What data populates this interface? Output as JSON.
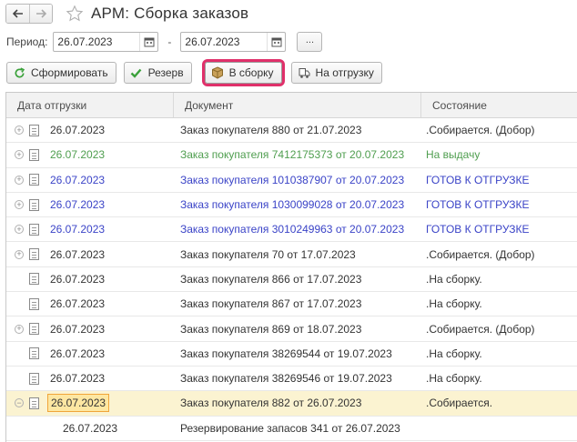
{
  "window": {
    "title": "АРМ: Сборка заказов"
  },
  "nav": {
    "back_icon": "arrow-left-icon",
    "forward_icon": "arrow-right-icon",
    "favorite_icon": "star-icon"
  },
  "period": {
    "label": "Период:",
    "from": "26.07.2023",
    "separator": "-",
    "to": "26.07.2023",
    "more_label": "..."
  },
  "toolbar": {
    "generate_label": "Сформировать",
    "reserve_label": "Резерв",
    "to_assembly_label": "В сборку",
    "to_shipment_label": "На отгрузку"
  },
  "table": {
    "columns": [
      "Дата отгрузки",
      "Документ",
      "Состояние"
    ],
    "rows": [
      {
        "date": "26.07.2023",
        "doc": "Заказ покупателя 880 от 21.07.2023",
        "state": ".Собирается. (Добор)"
      },
      {
        "date": "26.07.2023",
        "doc": "Заказ покупателя 7412175373 от 20.07.2023",
        "state": "На выдачу"
      },
      {
        "date": "26.07.2023",
        "doc": "Заказ покупателя 1010387907 от 20.07.2023",
        "state": "ГОТОВ К ОТГРУЗКЕ"
      },
      {
        "date": "26.07.2023",
        "doc": "Заказ покупателя 1030099028 от 20.07.2023",
        "state": "ГОТОВ К ОТГРУЗКЕ"
      },
      {
        "date": "26.07.2023",
        "doc": "Заказ покупателя 3010249963 от 20.07.2023",
        "state": "ГОТОВ К ОТГРУЗКЕ"
      },
      {
        "date": "26.07.2023",
        "doc": "Заказ покупателя 70 от 17.07.2023",
        "state": ".Собирается. (Добор)"
      },
      {
        "date": "26.07.2023",
        "doc": "Заказ покупателя 866 от 17.07.2023",
        "state": ".На сборку."
      },
      {
        "date": "26.07.2023",
        "doc": "Заказ покупателя 867 от 17.07.2023",
        "state": ".На сборку."
      },
      {
        "date": "26.07.2023",
        "doc": "Заказ покупателя 869 от 18.07.2023",
        "state": ".Собирается. (Добор)"
      },
      {
        "date": "26.07.2023",
        "doc": "Заказ покупателя 38269544 от 19.07.2023",
        "state": ".На сборку."
      },
      {
        "date": "26.07.2023",
        "doc": "Заказ покупателя 38269546 от 19.07.2023",
        "state": ".На сборку."
      },
      {
        "date": "26.07.2023",
        "doc": "Заказ покупателя 882 от 26.07.2023",
        "state": ".Собирается."
      },
      {
        "date": "26.07.2023",
        "doc": "Резервирование запасов 341 от 26.07.2023",
        "state": ""
      }
    ]
  },
  "colors": {
    "accent_highlight": "#e0306a",
    "green_text": "#4f9e4f",
    "blue_text": "#3a43c7",
    "selected_row": "#fbf3d1"
  }
}
